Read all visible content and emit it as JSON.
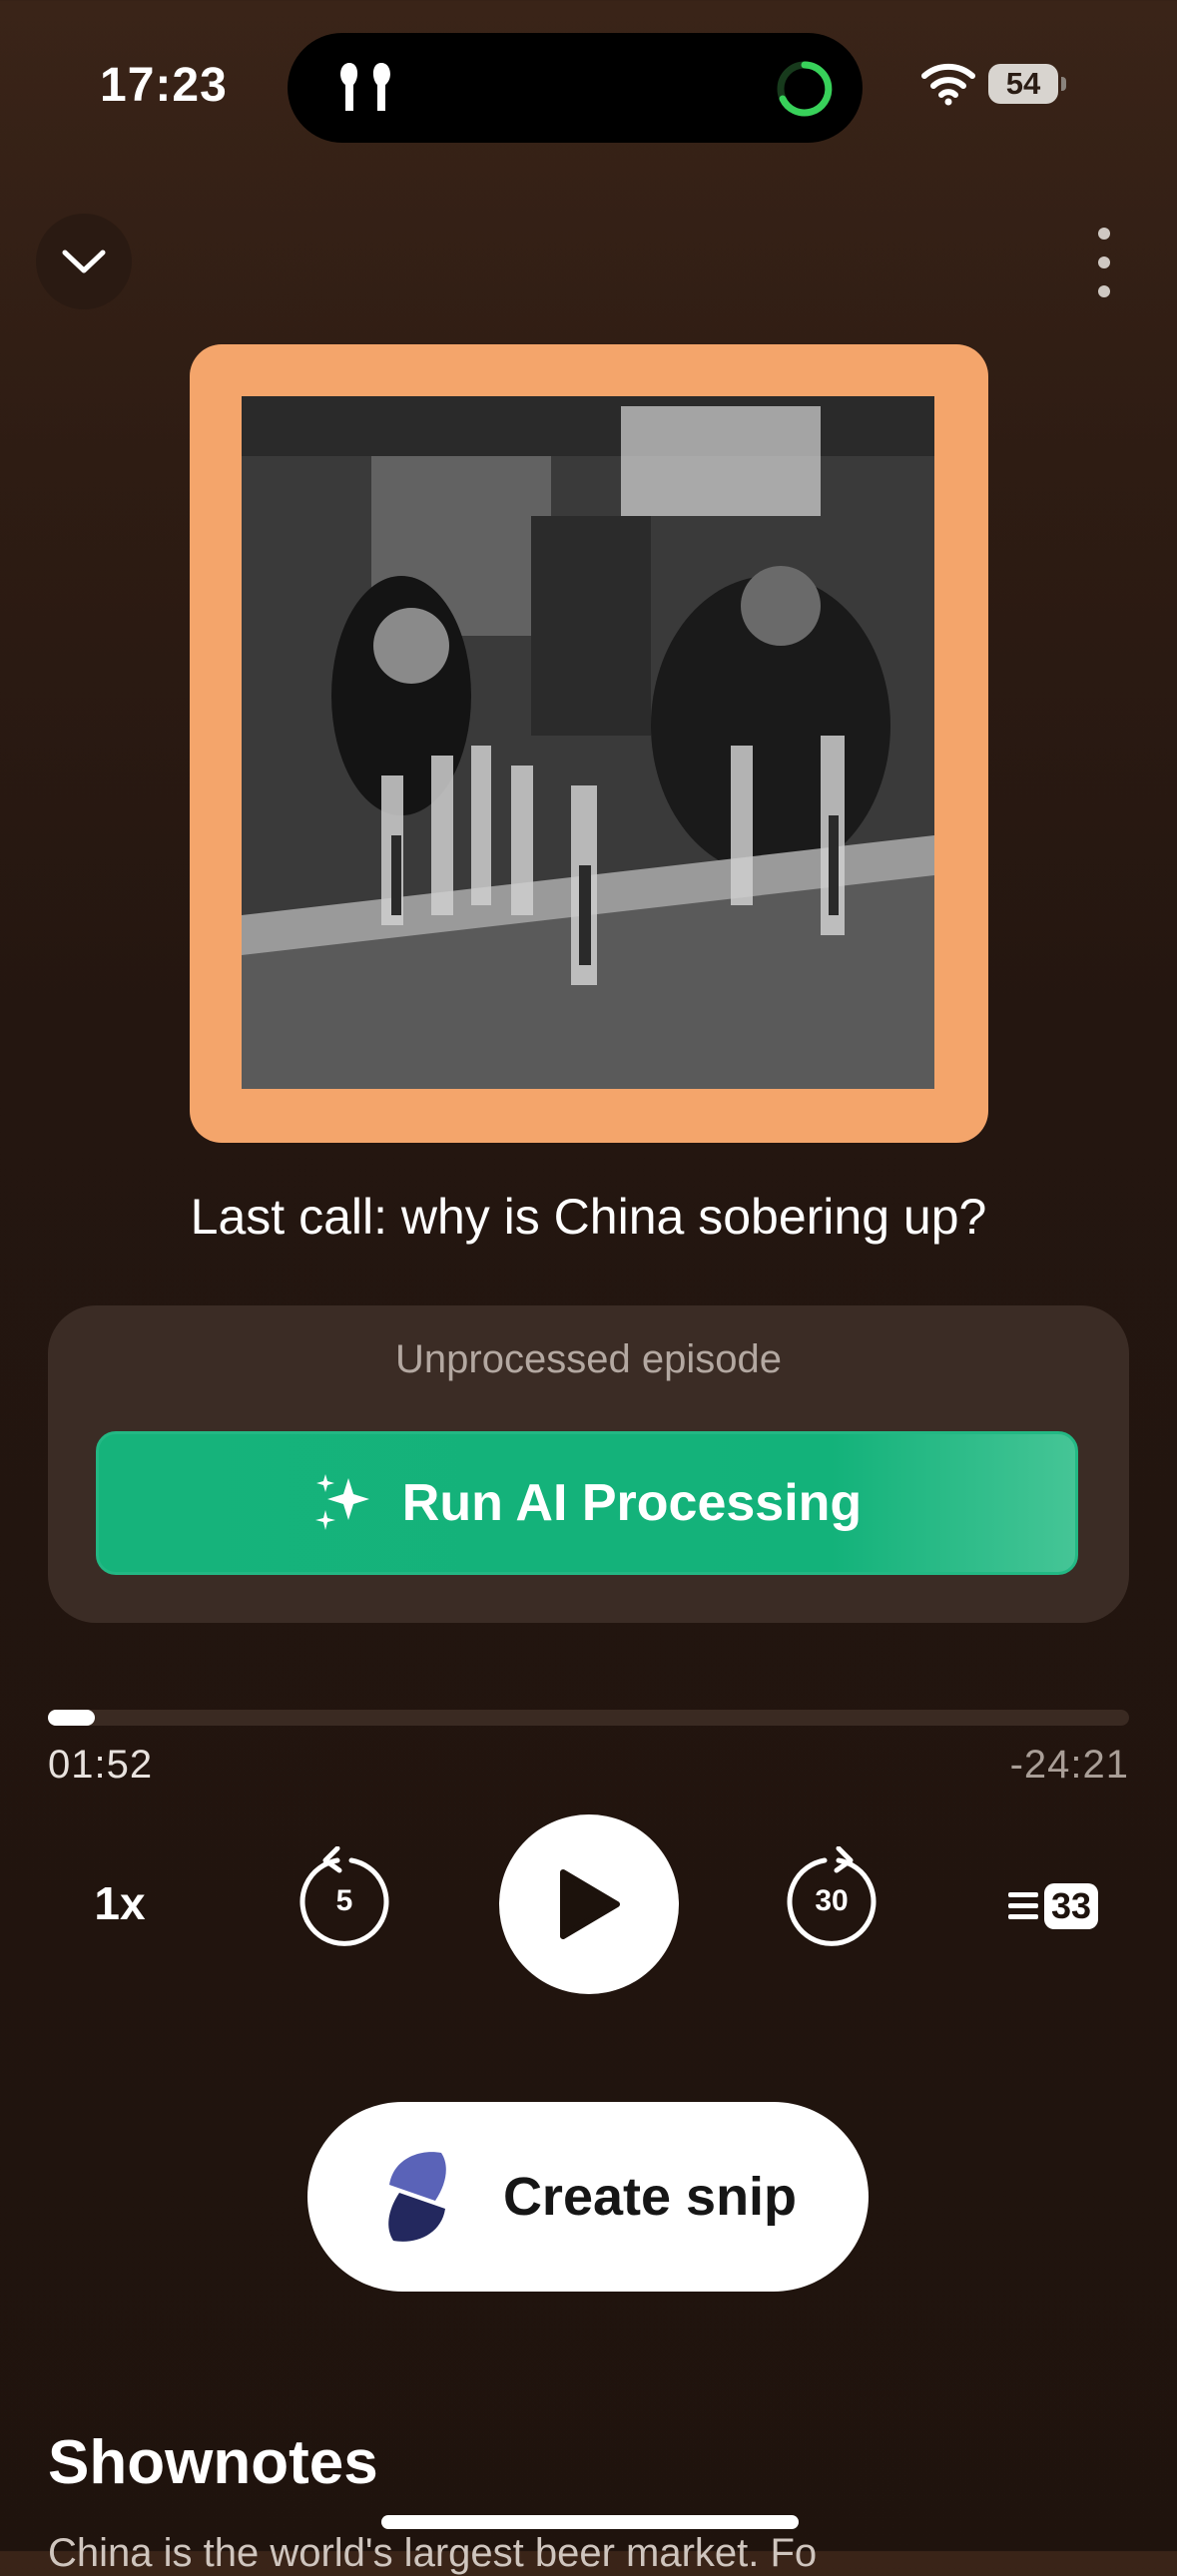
{
  "status_bar": {
    "time": "17:23",
    "battery": "54"
  },
  "episode": {
    "title": "Last call: why is China sobering up?"
  },
  "ai_card": {
    "status": "Unprocessed episode",
    "button_label": "Run AI Processing"
  },
  "player": {
    "elapsed": "01:52",
    "remaining": "-24:21",
    "progress_fraction": 0.043,
    "speed": "1x",
    "skip_back_seconds": "5",
    "skip_forward_seconds": "30",
    "queue_count": "33"
  },
  "snip": {
    "label": "Create snip"
  },
  "shownotes": {
    "title": "Shownotes",
    "preview": "China is the world's largest beer market. Fo"
  },
  "colors": {
    "artwork_frame": "#f4a56b",
    "accent_green": "#16b37b",
    "background": "#241610"
  },
  "icons": [
    "airpods-icon",
    "activity-ring-icon",
    "wifi-icon",
    "battery-icon",
    "chevron-down-icon",
    "more-vertical-icon",
    "sparkles-icon",
    "play-icon",
    "skip-back-icon",
    "skip-forward-icon",
    "queue-icon",
    "snipd-logo-icon"
  ]
}
